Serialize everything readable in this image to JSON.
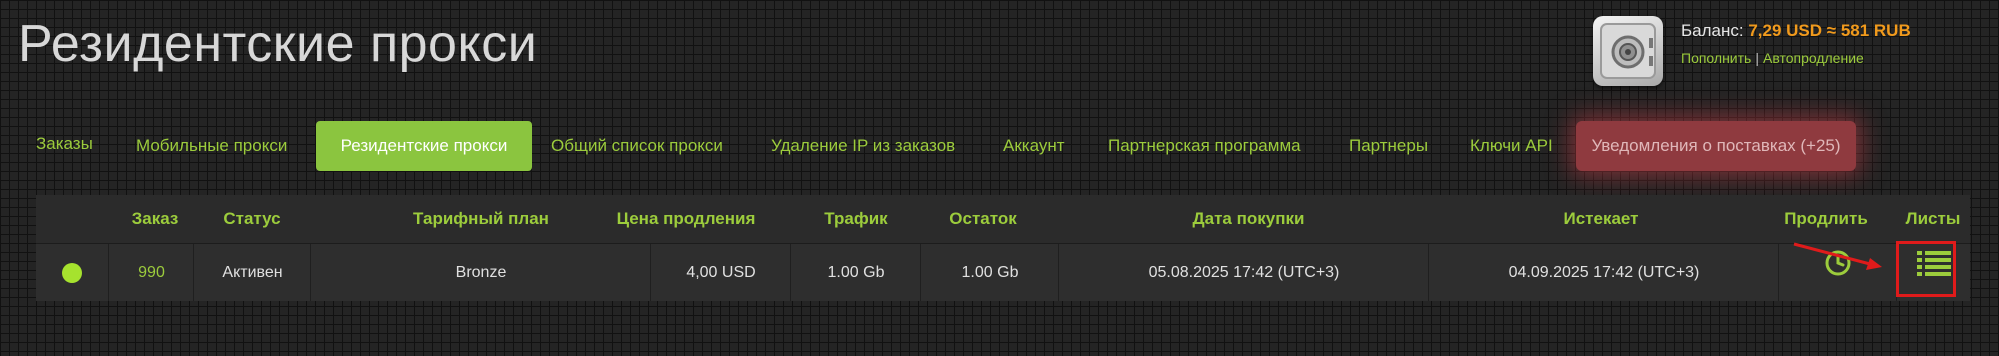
{
  "header": {
    "title": "Резидентские прокси"
  },
  "balance": {
    "label": "Баланс:",
    "amount": "7,29 USD ≈ 581 RUB",
    "topup_link": "Пополнить",
    "separator": "|",
    "autorenew_link": "Автопродление"
  },
  "tabs": [
    {
      "label": "Заказы"
    },
    {
      "label": "Мобильные прокси"
    },
    {
      "label": "Резидентские прокси",
      "active": true
    },
    {
      "label": "Общий список прокси"
    },
    {
      "label": "Удаление IP из заказов"
    },
    {
      "label": "Аккаунт"
    },
    {
      "label": "Партнерская программа"
    },
    {
      "label": "Партнеры"
    },
    {
      "label": "Ключи API"
    },
    {
      "label": "Уведомления о поставках (+25)"
    }
  ],
  "table": {
    "headers": {
      "order": "Заказ",
      "status": "Статус",
      "plan": "Тарифный план",
      "renew_price": "Цена продления",
      "traffic": "Трафик",
      "remaining": "Остаток",
      "purchase_date": "Дата покупки",
      "expires": "Истекает",
      "renew": "Продлить",
      "lists": "Листы"
    },
    "rows": [
      {
        "status_indicator": "active",
        "order": "990",
        "status": "Активен",
        "plan": "Bronze",
        "renew_price": "4,00 USD",
        "traffic": "1.00 Gb",
        "remaining": "1.00 Gb",
        "purchase_date": "05.08.2025 17:42 (UTC+3)",
        "expires": "04.09.2025 17:42 (UTC+3)",
        "renew_icon": "clock-icon",
        "lists_icon": "list-icon"
      }
    ]
  },
  "colors": {
    "accent_green": "#8bc53f",
    "link_green": "#9ccc3c",
    "balance_orange": "#f19a1c",
    "notice_red": "#8f3a3f",
    "annotation_red": "#e01b1b"
  }
}
